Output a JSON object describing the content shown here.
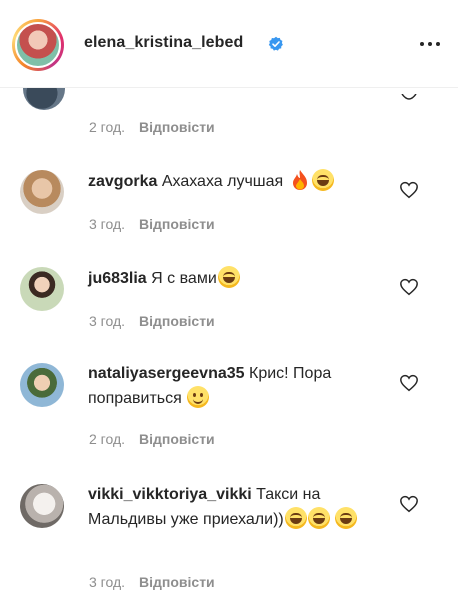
{
  "header": {
    "username": "elena_kristina_lebed",
    "verified_color": "#3897f0"
  },
  "partial_comment": {
    "time": "2 год.",
    "reply_label": "Відповісти"
  },
  "comments": [
    {
      "username": "zavgorka",
      "text": "Ахахаха лучшая",
      "emojis": [
        "fire",
        "laugh"
      ],
      "time": "3 год.",
      "reply_label": "Відповісти"
    },
    {
      "username": "ju683lia",
      "text": "Я с вами",
      "emojis": [
        "laugh"
      ],
      "time": "3 год.",
      "reply_label": "Відповісти"
    },
    {
      "username": "nataliyasergeevna35",
      "text": "Крис! Пора поправиться",
      "emojis": [
        "smile"
      ],
      "time": "2 год.",
      "reply_label": "Відповісти"
    },
    {
      "username": "vikki_vikktoriya_vikki",
      "text": "Такси на Мальдивы уже приехали))",
      "emojis": [
        "laugh",
        "laugh",
        "laugh"
      ],
      "time": "3 год.",
      "reply_label": "Відповісти"
    }
  ],
  "icons": {
    "more": "more-horizontal-icon",
    "like": "heart-outline-icon",
    "verified": "verified-badge-icon"
  }
}
